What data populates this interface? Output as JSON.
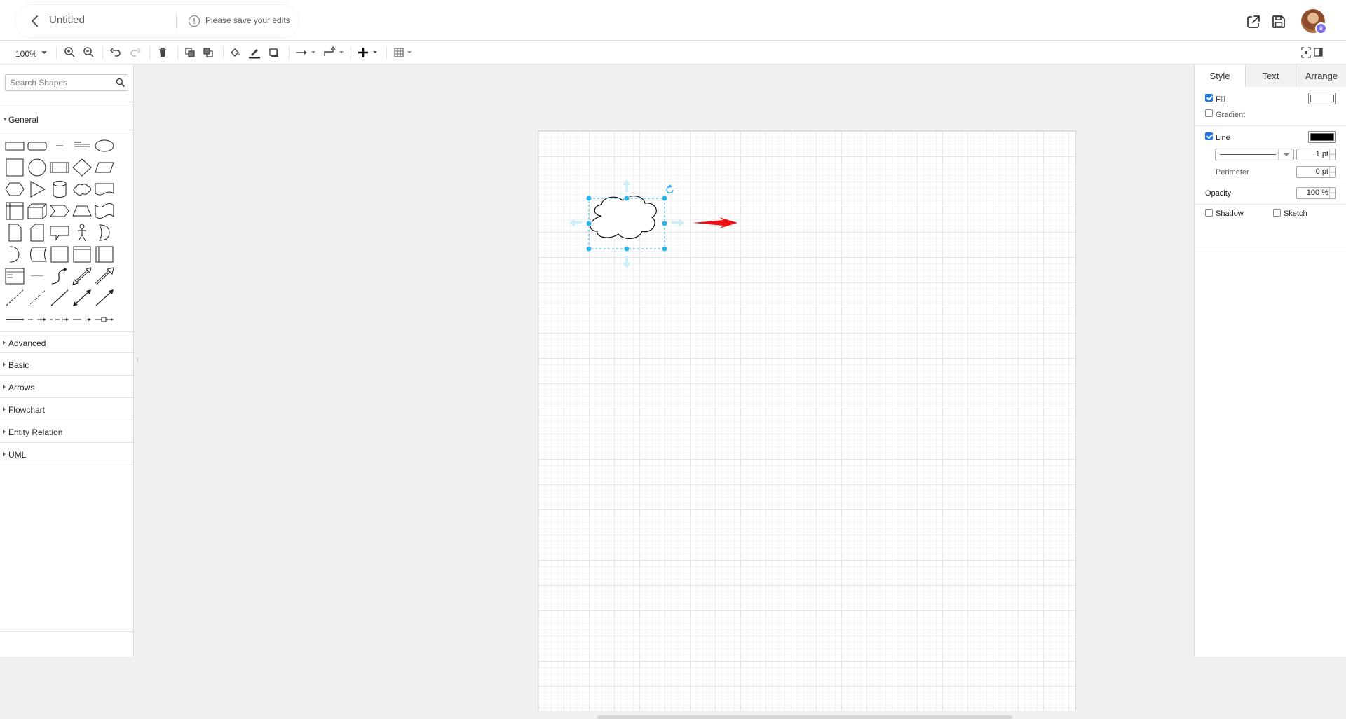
{
  "header": {
    "doc_title": "Untitled",
    "save_note": "Please save your edits"
  },
  "toolbar": {
    "zoom_level": "100%"
  },
  "sidebar": {
    "search_placeholder": "Search Shapes",
    "categories": [
      {
        "label": "General",
        "expanded": true
      },
      {
        "label": "Advanced",
        "expanded": false
      },
      {
        "label": "Basic",
        "expanded": false
      },
      {
        "label": "Arrows",
        "expanded": false
      },
      {
        "label": "Flowchart",
        "expanded": false
      },
      {
        "label": "Entity Relation",
        "expanded": false
      },
      {
        "label": "UML",
        "expanded": false
      }
    ]
  },
  "format_panel": {
    "tabs": [
      {
        "label": "Style",
        "active": true
      },
      {
        "label": "Text",
        "active": false
      },
      {
        "label": "Arrange",
        "active": false
      }
    ],
    "fill": {
      "label": "Fill",
      "checked": true,
      "color": "#ffffff"
    },
    "gradient": {
      "label": "Gradient",
      "checked": false
    },
    "line": {
      "label": "Line",
      "checked": true,
      "color": "#000000",
      "width": "1 pt"
    },
    "perimeter": {
      "label": "Perimeter",
      "value": "0 pt"
    },
    "opacity": {
      "label": "Opacity",
      "value": "100 %"
    },
    "shadow": {
      "label": "Shadow",
      "checked": false
    },
    "sketch": {
      "label": "Sketch",
      "checked": false
    }
  },
  "colors": {
    "selection": "#29b6f2",
    "accent_arrow": "#ee1111"
  }
}
